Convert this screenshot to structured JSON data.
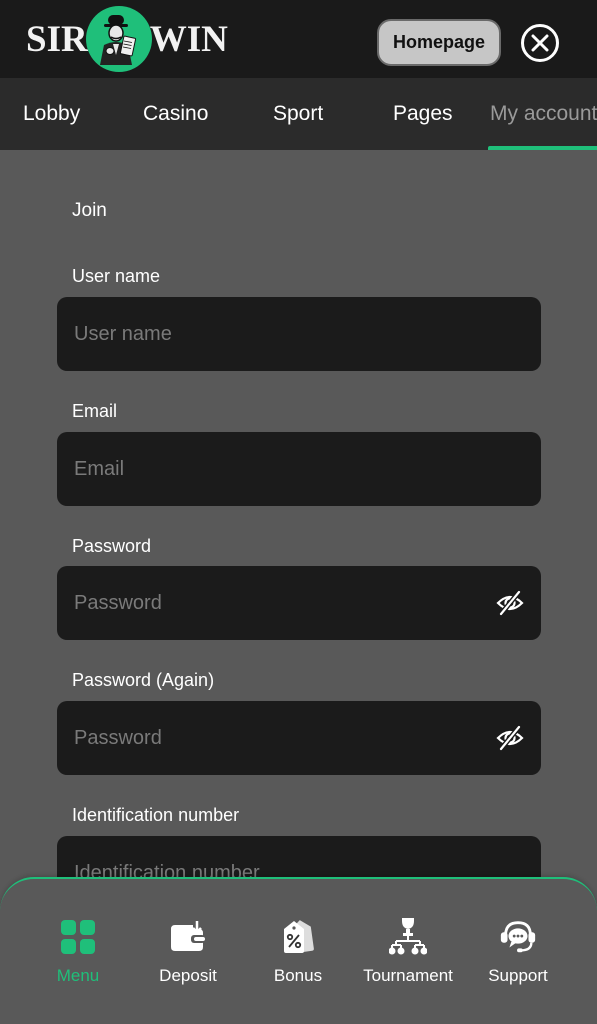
{
  "header": {
    "logo_left": "SIR",
    "logo_right": "WIN",
    "homepage_label": "Homepage",
    "close_icon": "close-circle-icon"
  },
  "tabs": [
    {
      "label": "Lobby",
      "active": false
    },
    {
      "label": "Casino",
      "active": false
    },
    {
      "label": "Sport",
      "active": false
    },
    {
      "label": "Pages",
      "active": false
    },
    {
      "label": "My account",
      "active": true
    }
  ],
  "form": {
    "title": "Join",
    "fields": [
      {
        "label": "User name",
        "placeholder": "User name",
        "value": "",
        "type": "text"
      },
      {
        "label": "Email",
        "placeholder": "Email",
        "value": "",
        "type": "email"
      },
      {
        "label": "Password",
        "placeholder": "Password",
        "value": "",
        "type": "password",
        "icon": "eye-off-icon"
      },
      {
        "label": "Password (Again)",
        "placeholder": "Password",
        "value": "",
        "type": "password",
        "icon": "eye-off-icon"
      },
      {
        "label": "Identification number",
        "placeholder": "Identification number",
        "value": "",
        "type": "text"
      }
    ]
  },
  "bottom_nav": [
    {
      "label": "Menu",
      "icon": "grid-icon",
      "active": true
    },
    {
      "label": "Deposit",
      "icon": "wallet-icon",
      "active": false
    },
    {
      "label": "Bonus",
      "icon": "discount-tag-icon",
      "active": false
    },
    {
      "label": "Tournament",
      "icon": "tournament-bracket-icon",
      "active": false
    },
    {
      "label": "Support",
      "icon": "support-headset-icon",
      "active": false
    }
  ],
  "colors": {
    "accent": "#1fbf7a",
    "header_bg": "#1a1a1a",
    "tabs_bg": "#2b2b2b",
    "page_bg": "#595959",
    "field_bg": "#1b1b1b"
  }
}
